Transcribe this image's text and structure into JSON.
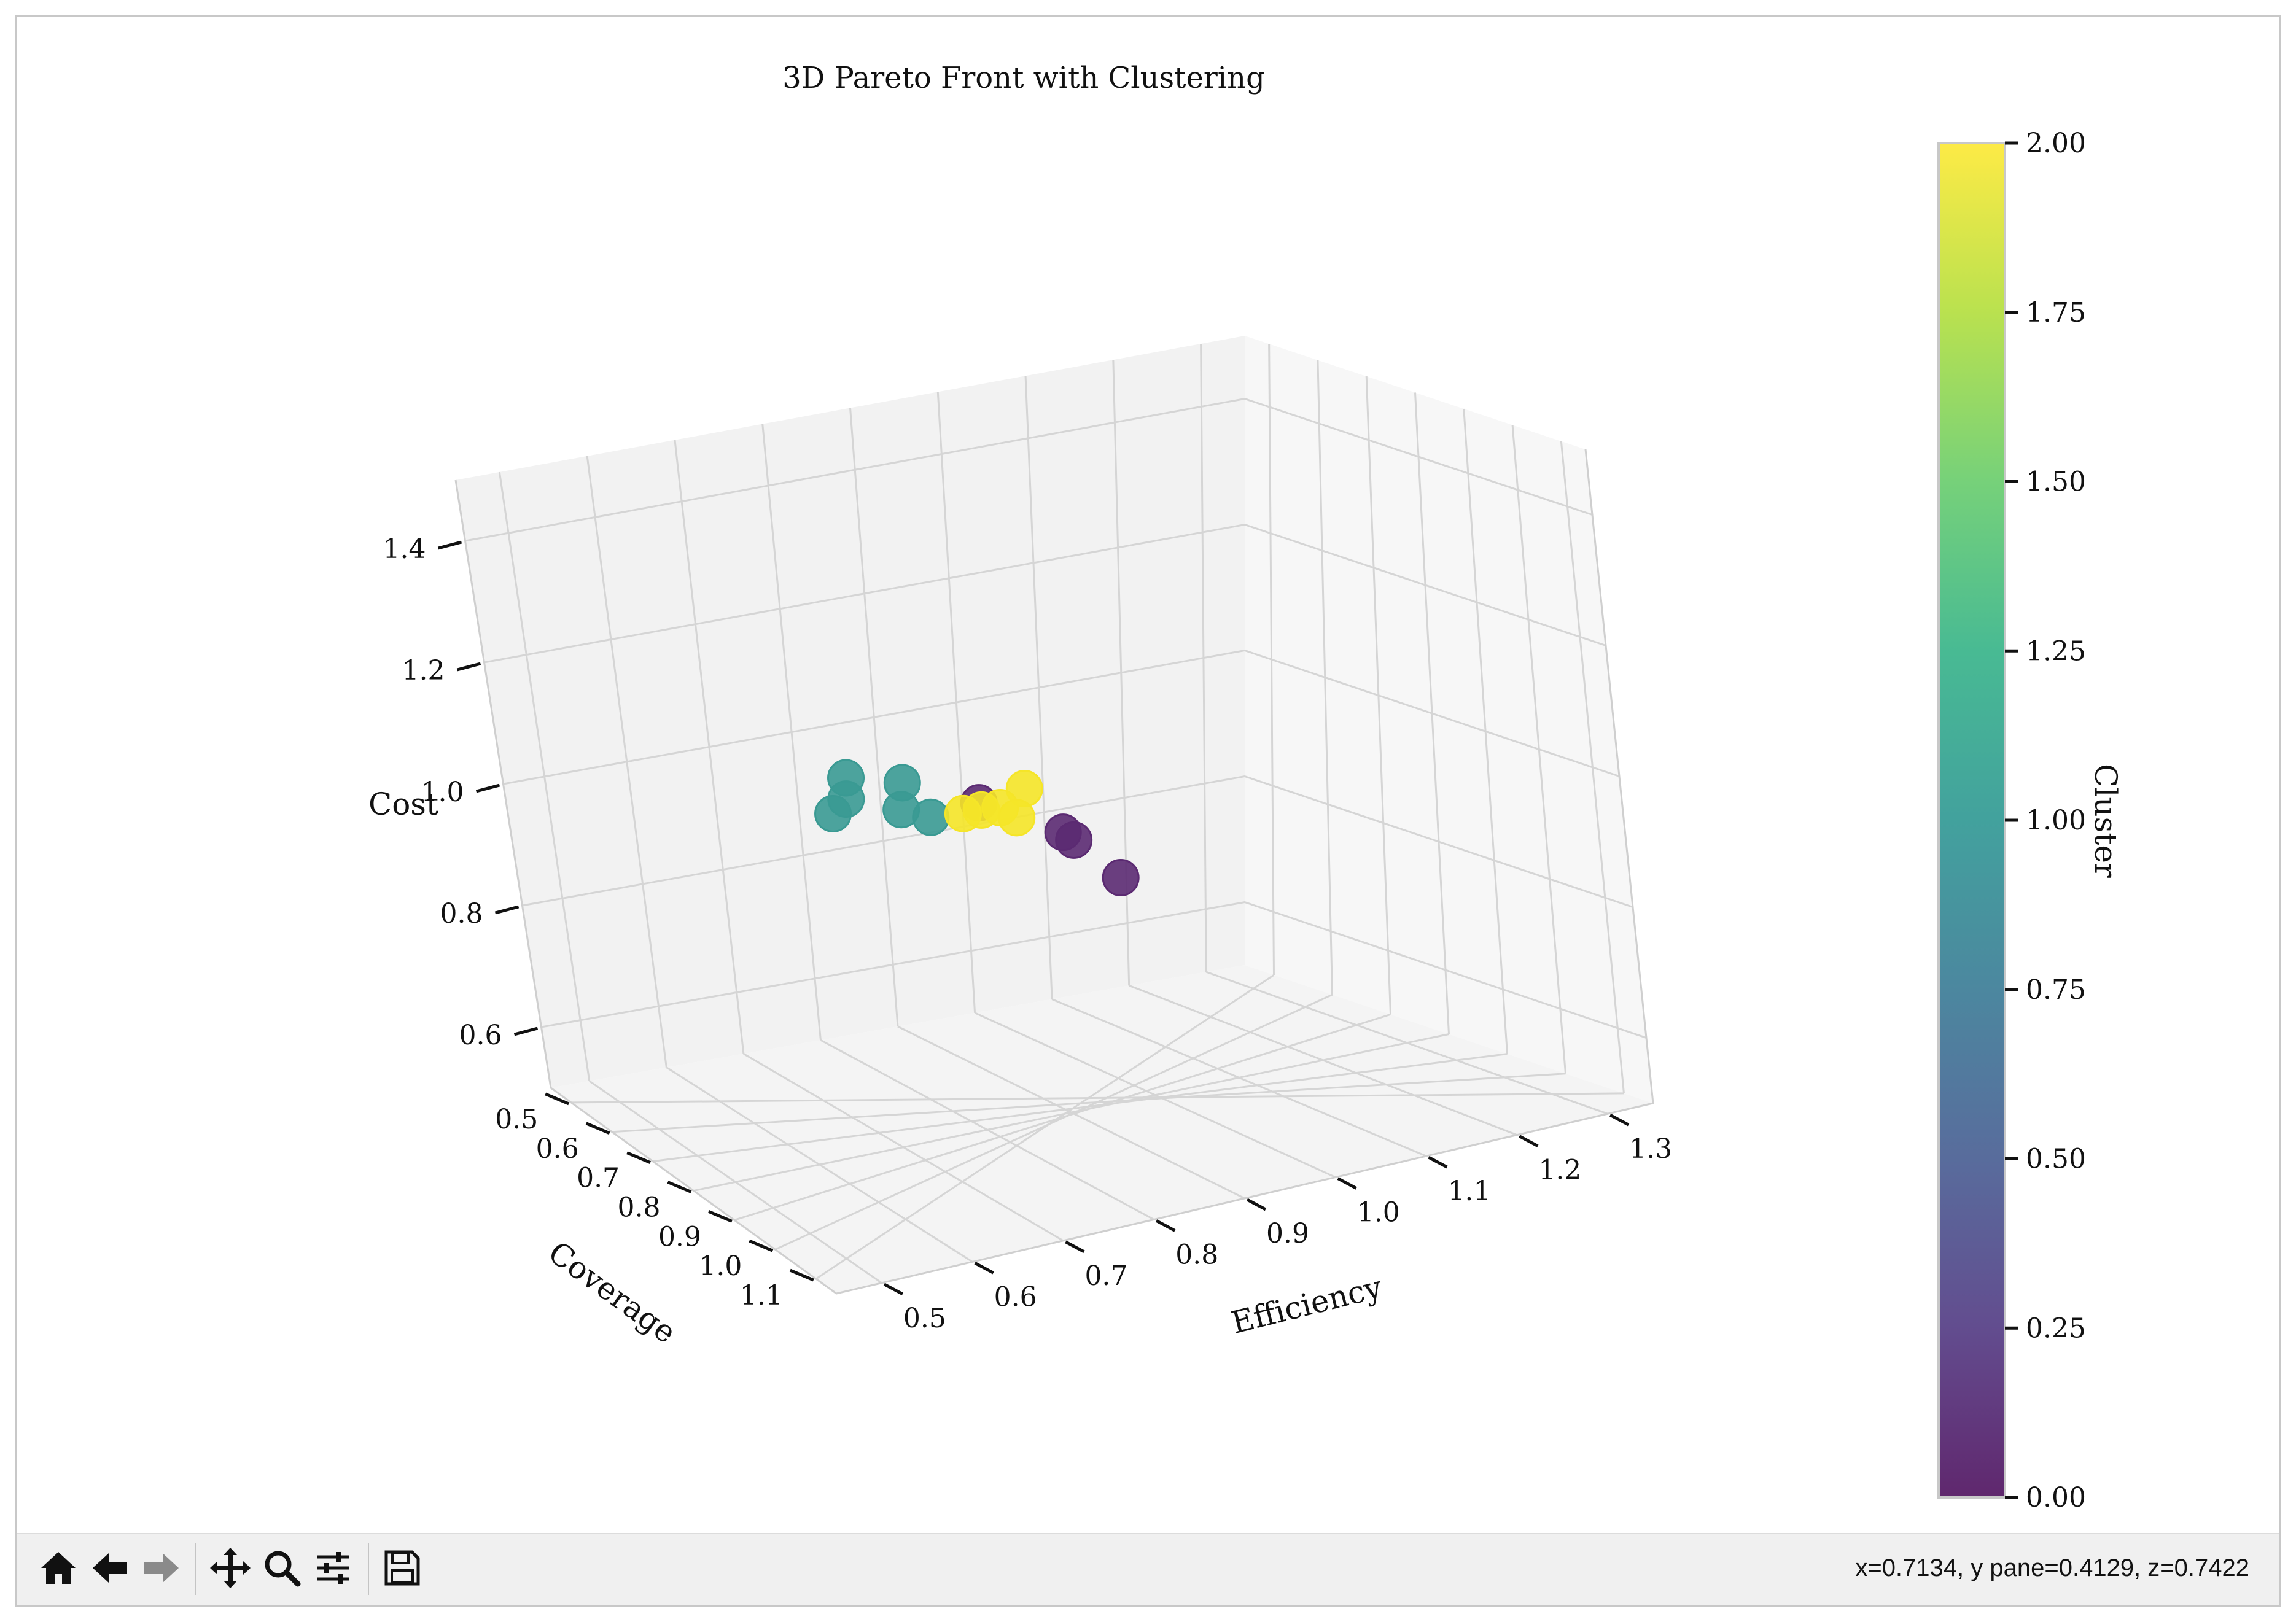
{
  "figure": {
    "title": "3D Pareto Front with Clustering"
  },
  "colorbar": {
    "label": "Cluster",
    "ticks": [
      "0.00",
      "0.25",
      "0.50",
      "0.75",
      "1.00",
      "1.25",
      "1.50",
      "1.75",
      "2.00"
    ],
    "colormap": "viridis",
    "range": [
      0,
      2
    ]
  },
  "toolbar": {
    "icons": [
      "home-icon",
      "back-arrow-icon",
      "forward-arrow-icon",
      "pan-icon",
      "zoom-icon",
      "configure-subplots-icon",
      "save-icon"
    ],
    "coordinates": "x=0.7134, y pane=0.4129, z=0.7422"
  },
  "colors": {
    "cluster_0": "#5b2a72",
    "cluster_1": "#3a9a93",
    "cluster_2": "#f5e528",
    "pane_back": "#f2f2f2",
    "pane_side": "#f7f7f7",
    "grid": "#d5d5d5",
    "toolbar_bg": "#f0f0f0"
  },
  "chart_data": {
    "type": "scatter",
    "projection": "3d",
    "title": "3D Pareto Front with Clustering",
    "xlabel": "Efficiency",
    "ylabel": "Coverage",
    "zlabel": "Cost",
    "x_ticks": [
      "0.5",
      "0.6",
      "0.7",
      "0.8",
      "0.9",
      "1.0",
      "1.1",
      "1.2",
      "1.3"
    ],
    "y_ticks": [
      "0.5",
      "0.6",
      "0.7",
      "0.8",
      "0.9",
      "1.0",
      "1.1"
    ],
    "z_ticks": [
      "0.6",
      "0.8",
      "1.0",
      "1.2",
      "1.4"
    ],
    "xlim": [
      0.45,
      1.35
    ],
    "ylim": [
      0.45,
      1.15
    ],
    "zlim": [
      0.5,
      1.5
    ],
    "grid": true,
    "series": [
      {
        "cluster": 0,
        "points": [
          {
            "x": 0.66,
            "y": 0.52,
            "z": 0.71
          },
          {
            "x": 0.72,
            "y": 0.5,
            "z": 0.79
          },
          {
            "x": 0.74,
            "y": 0.55,
            "z": 0.8
          },
          {
            "x": 0.86,
            "y": 0.55,
            "z": 0.89
          }
        ]
      },
      {
        "cluster": 1,
        "points": [
          {
            "x": 1.25,
            "y": 0.96,
            "z": 1.22
          },
          {
            "x": 1.23,
            "y": 0.92,
            "z": 1.16
          },
          {
            "x": 1.17,
            "y": 0.93,
            "z": 1.17
          },
          {
            "x": 1.22,
            "y": 0.87,
            "z": 1.11
          },
          {
            "x": 1.14,
            "y": 0.87,
            "z": 1.09
          },
          {
            "x": 1.1,
            "y": 0.86,
            "z": 1.06
          }
        ]
      },
      {
        "cluster": 2,
        "points": [
          {
            "x": 1.04,
            "y": 0.82,
            "z": 1.03
          },
          {
            "x": 0.99,
            "y": 0.77,
            "z": 1.0
          },
          {
            "x": 0.95,
            "y": 0.79,
            "z": 1.03
          },
          {
            "x": 0.95,
            "y": 0.74,
            "z": 0.98
          },
          {
            "x": 0.9,
            "y": 0.69,
            "z": 0.93
          }
        ]
      }
    ]
  }
}
